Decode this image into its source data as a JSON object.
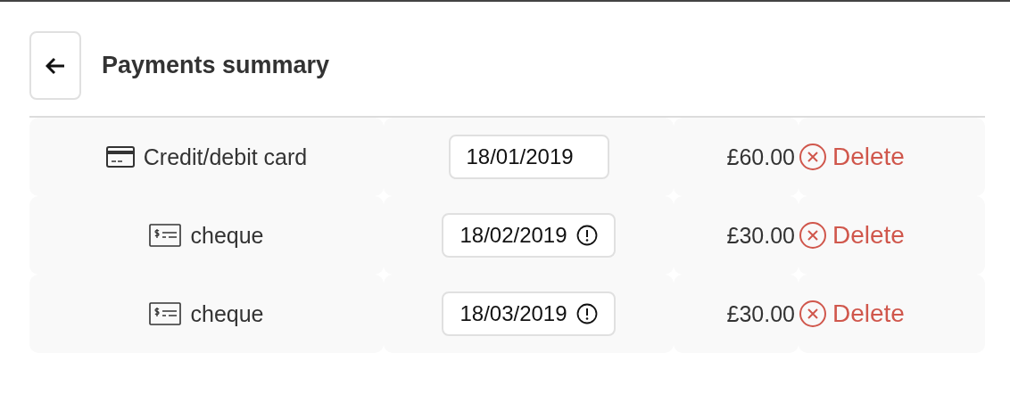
{
  "header": {
    "title": "Payments summary"
  },
  "payments": [
    {
      "kind": "card",
      "method": "Credit/debit card",
      "date": "18/01/2019",
      "warning": false,
      "amount": "£60.00",
      "action": "Delete"
    },
    {
      "kind": "cheque",
      "method": "cheque",
      "date": "18/02/2019",
      "warning": true,
      "amount": "£30.00",
      "action": "Delete"
    },
    {
      "kind": "cheque",
      "method": "cheque",
      "date": "18/03/2019",
      "warning": true,
      "amount": "£30.00",
      "action": "Delete"
    }
  ]
}
